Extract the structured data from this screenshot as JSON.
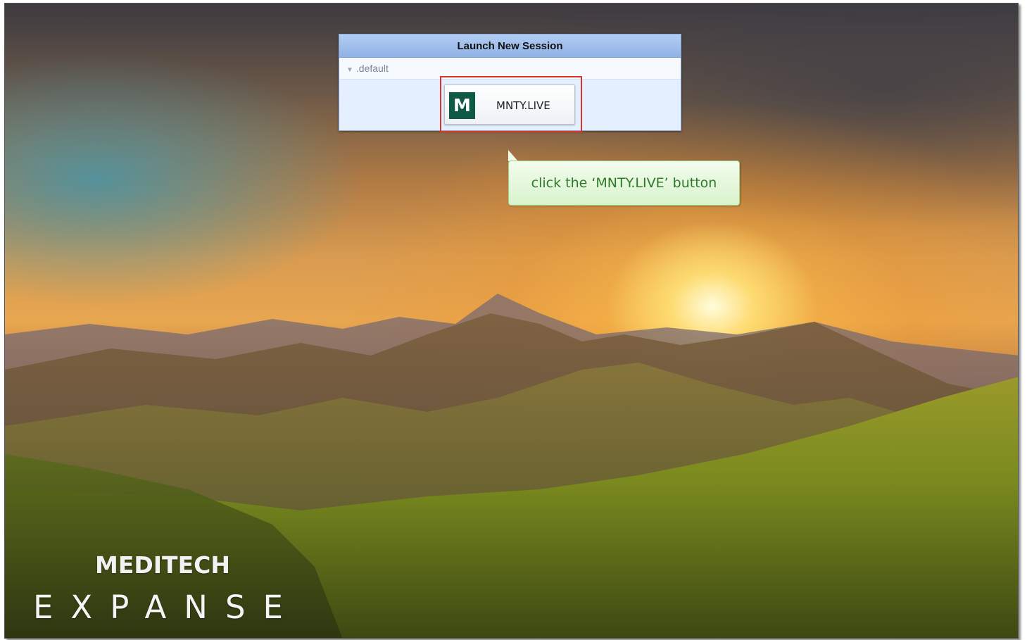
{
  "dialog": {
    "title": "Launch New Session",
    "group_label": ".default",
    "group_icon": "triangle-down-icon",
    "session_button": {
      "icon_letter": "M",
      "label": "MNTY.LIVE",
      "icon_color": "#0f5a46"
    }
  },
  "callout": {
    "text": "click the ‘MNTY.LIVE’ button",
    "color": "#2e7a2a"
  },
  "branding": {
    "line1": "MEDITECH",
    "line2": "EXPANSE"
  },
  "colors": {
    "highlight_border": "#d9372b",
    "title_bar": "#a5c2ef"
  }
}
